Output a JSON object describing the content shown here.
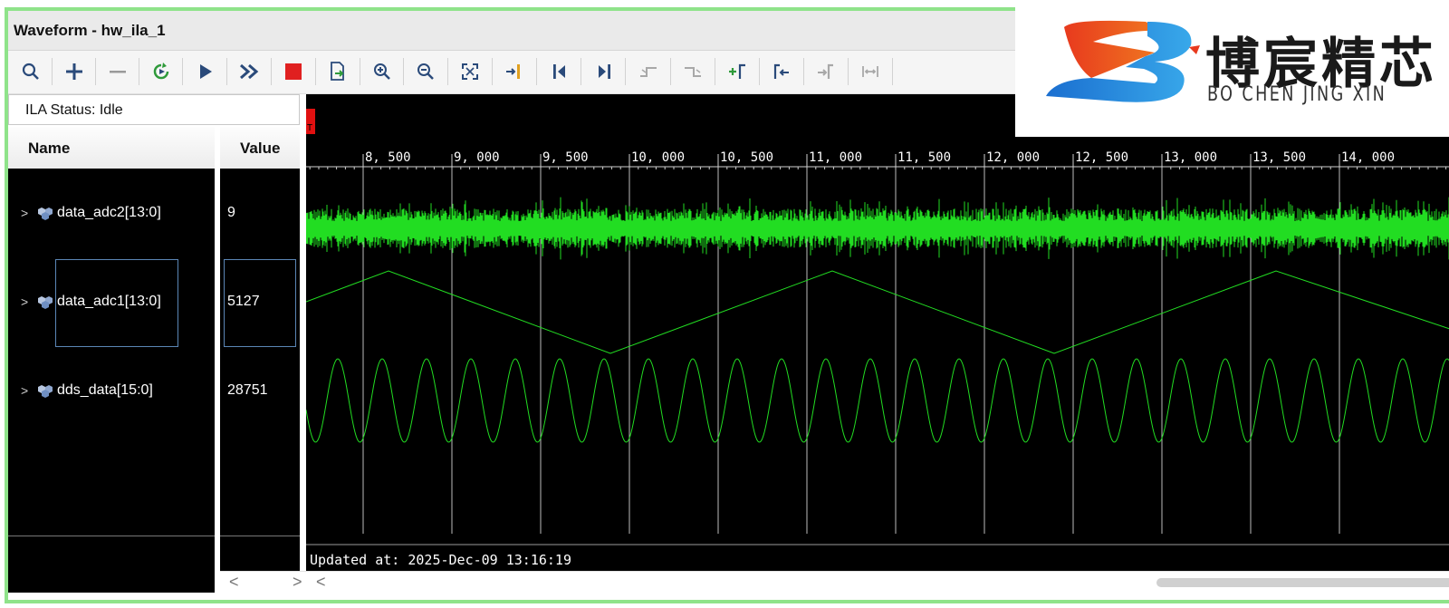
{
  "window": {
    "title": "Waveform - hw_ila_1"
  },
  "toolbar": {
    "icons": [
      "search-icon",
      "add-icon",
      "remove-icon",
      "run-trigger-icon",
      "play-icon",
      "fast-forward-icon",
      "stop-icon",
      "export-icon",
      "zoom-in-icon",
      "zoom-out-icon",
      "zoom-fit-icon",
      "go-to-cursor-icon",
      "go-to-start-icon",
      "go-to-end-icon",
      "prev-transition-icon",
      "next-transition-icon",
      "add-marker-icon",
      "prev-marker-icon",
      "next-marker-icon",
      "swap-cursors-icon"
    ]
  },
  "ila_status": {
    "label": "ILA Status:",
    "value": "Idle"
  },
  "columns": {
    "name": "Name",
    "value": "Value"
  },
  "signals": [
    {
      "name": "data_adc2[13:0]",
      "value": "9",
      "wave": "noise"
    },
    {
      "name": "data_adc1[13:0]",
      "value": "5127",
      "wave": "triangle"
    },
    {
      "name": "dds_data[15:0]",
      "value": "28751",
      "wave": "sine"
    }
  ],
  "timeline": {
    "ticks": [
      "8, 500",
      "9, 000",
      "9, 500",
      "10, 000",
      "10, 500",
      "11, 000",
      "11, 500",
      "12, 000",
      "12, 500",
      "13, 000",
      "13, 500",
      "14, 000"
    ],
    "trigger_marker": "T"
  },
  "updated_at": "Updated at: 2025-Dec-09 13:16:19",
  "logo": {
    "cn": "博宸精芯",
    "en": "BO CHEN JING XIN"
  },
  "colors": {
    "wave": "#22dd22",
    "frame_border": "#8fe38a",
    "selection": "#5b86b6",
    "stop": "#e02020"
  }
}
